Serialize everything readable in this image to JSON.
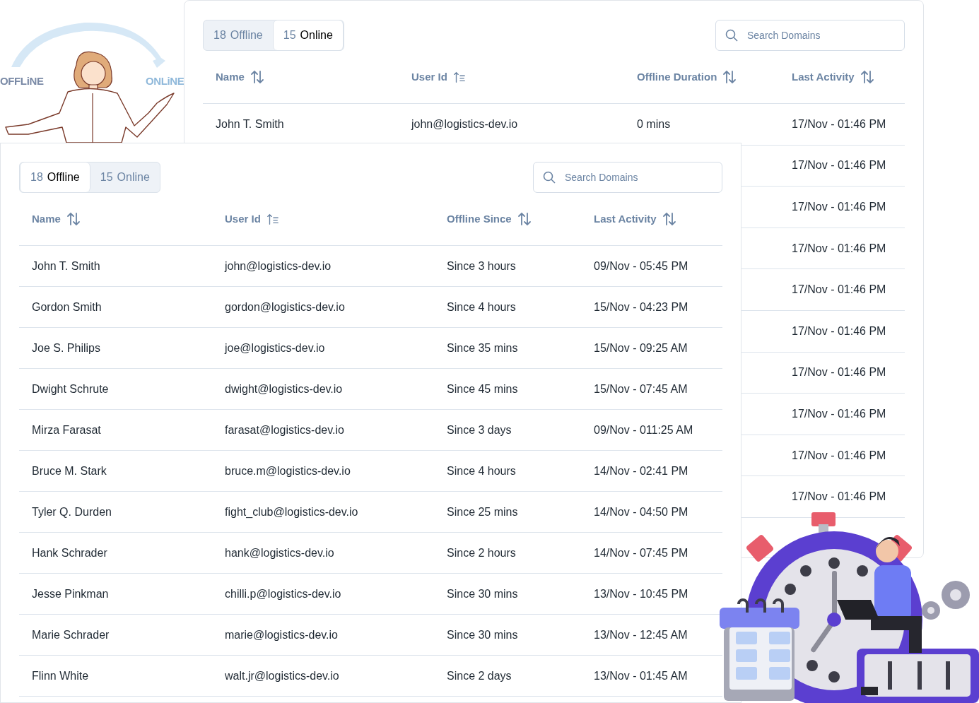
{
  "illustration_left": {
    "from_label": "OFFLiNE",
    "to_label": "ONLiNE"
  },
  "back_panel": {
    "tabs": [
      {
        "count": "18",
        "label": "Offline",
        "selected": false
      },
      {
        "count": "15",
        "label": "Online",
        "selected": true
      }
    ],
    "search": {
      "placeholder": "Search Domains"
    },
    "table": {
      "columns": [
        {
          "label": "Name",
          "kind": "both"
        },
        {
          "label": "User Id",
          "kind": "asc"
        },
        {
          "label": "Offline Duration",
          "kind": "both"
        },
        {
          "label": "Last Activity",
          "kind": "both"
        }
      ],
      "rows": [
        {
          "name": "John T. Smith",
          "user_id": "john@logistics-dev.io",
          "duration": "0 mins",
          "last_activity": "17/Nov - 01:46 PM"
        },
        {
          "last_activity": "17/Nov - 01:46 PM"
        },
        {
          "last_activity": "17/Nov - 01:46 PM"
        },
        {
          "last_activity": "17/Nov - 01:46 PM"
        },
        {
          "last_activity": "17/Nov - 01:46 PM"
        },
        {
          "last_activity": "17/Nov - 01:46 PM"
        },
        {
          "last_activity": "17/Nov - 01:46 PM"
        },
        {
          "last_activity": "17/Nov - 01:46 PM"
        },
        {
          "last_activity": "17/Nov - 01:46 PM"
        },
        {
          "last_activity": "17/Nov - 01:46 PM"
        }
      ]
    }
  },
  "front_panel": {
    "tabs": [
      {
        "count": "18",
        "label": "Offline",
        "selected": true
      },
      {
        "count": "15",
        "label": "Online",
        "selected": false
      }
    ],
    "search": {
      "placeholder": "Search Domains"
    },
    "table": {
      "columns": [
        {
          "label": "Name",
          "kind": "both"
        },
        {
          "label": "User Id",
          "kind": "asc"
        },
        {
          "label": "Offline Since",
          "kind": "both"
        },
        {
          "label": "Last Activity",
          "kind": "both"
        }
      ],
      "rows": [
        {
          "name": "John T. Smith",
          "user_id": "john@logistics-dev.io",
          "duration": "Since 3 hours",
          "last_activity": "09/Nov - 05:45 PM"
        },
        {
          "name": "Gordon Smith",
          "user_id": "gordon@logistics-dev.io",
          "duration": "Since 4 hours",
          "last_activity": "15/Nov - 04:23 PM"
        },
        {
          "name": "Joe S. Philips",
          "user_id": "joe@logistics-dev.io",
          "duration": "Since 35 mins",
          "last_activity": "15/Nov - 09:25 AM"
        },
        {
          "name": "Dwight Schrute",
          "user_id": "dwight@logistics-dev.io",
          "duration": "Since 45 mins",
          "last_activity": "15/Nov - 07:45 AM"
        },
        {
          "name": "Mirza Farasat",
          "user_id": "farasat@logistics-dev.io",
          "duration": "Since 3 days",
          "last_activity": "09/Nov - 011:25 AM"
        },
        {
          "name": "Bruce M. Stark",
          "user_id": "bruce.m@logistics-dev.io",
          "duration": "Since 4 hours",
          "last_activity": "14/Nov - 02:41 PM"
        },
        {
          "name": "Tyler Q. Durden",
          "user_id": "fight_club@logistics-dev.io",
          "duration": "Since 25 mins",
          "last_activity": "14/Nov - 04:50 PM"
        },
        {
          "name": "Hank Schrader",
          "user_id": "hank@logistics-dev.io",
          "duration": "Since 2 hours",
          "last_activity": "14/Nov - 07:45 PM"
        },
        {
          "name": "Jesse Pinkman",
          "user_id": "chilli.p@logistics-dev.io",
          "duration": "Since 30 mins",
          "last_activity": "13/Nov - 10:45 PM"
        },
        {
          "name": "Marie Schrader",
          "user_id": "marie@logistics-dev.io",
          "duration": "Since 30 mins",
          "last_activity": "13/Nov - 12:45 AM"
        },
        {
          "name": "Flinn White",
          "user_id": "walt.jr@logistics-dev.io",
          "duration": "Since 2 days",
          "last_activity": "13/Nov - 01:45 AM"
        }
      ]
    }
  }
}
